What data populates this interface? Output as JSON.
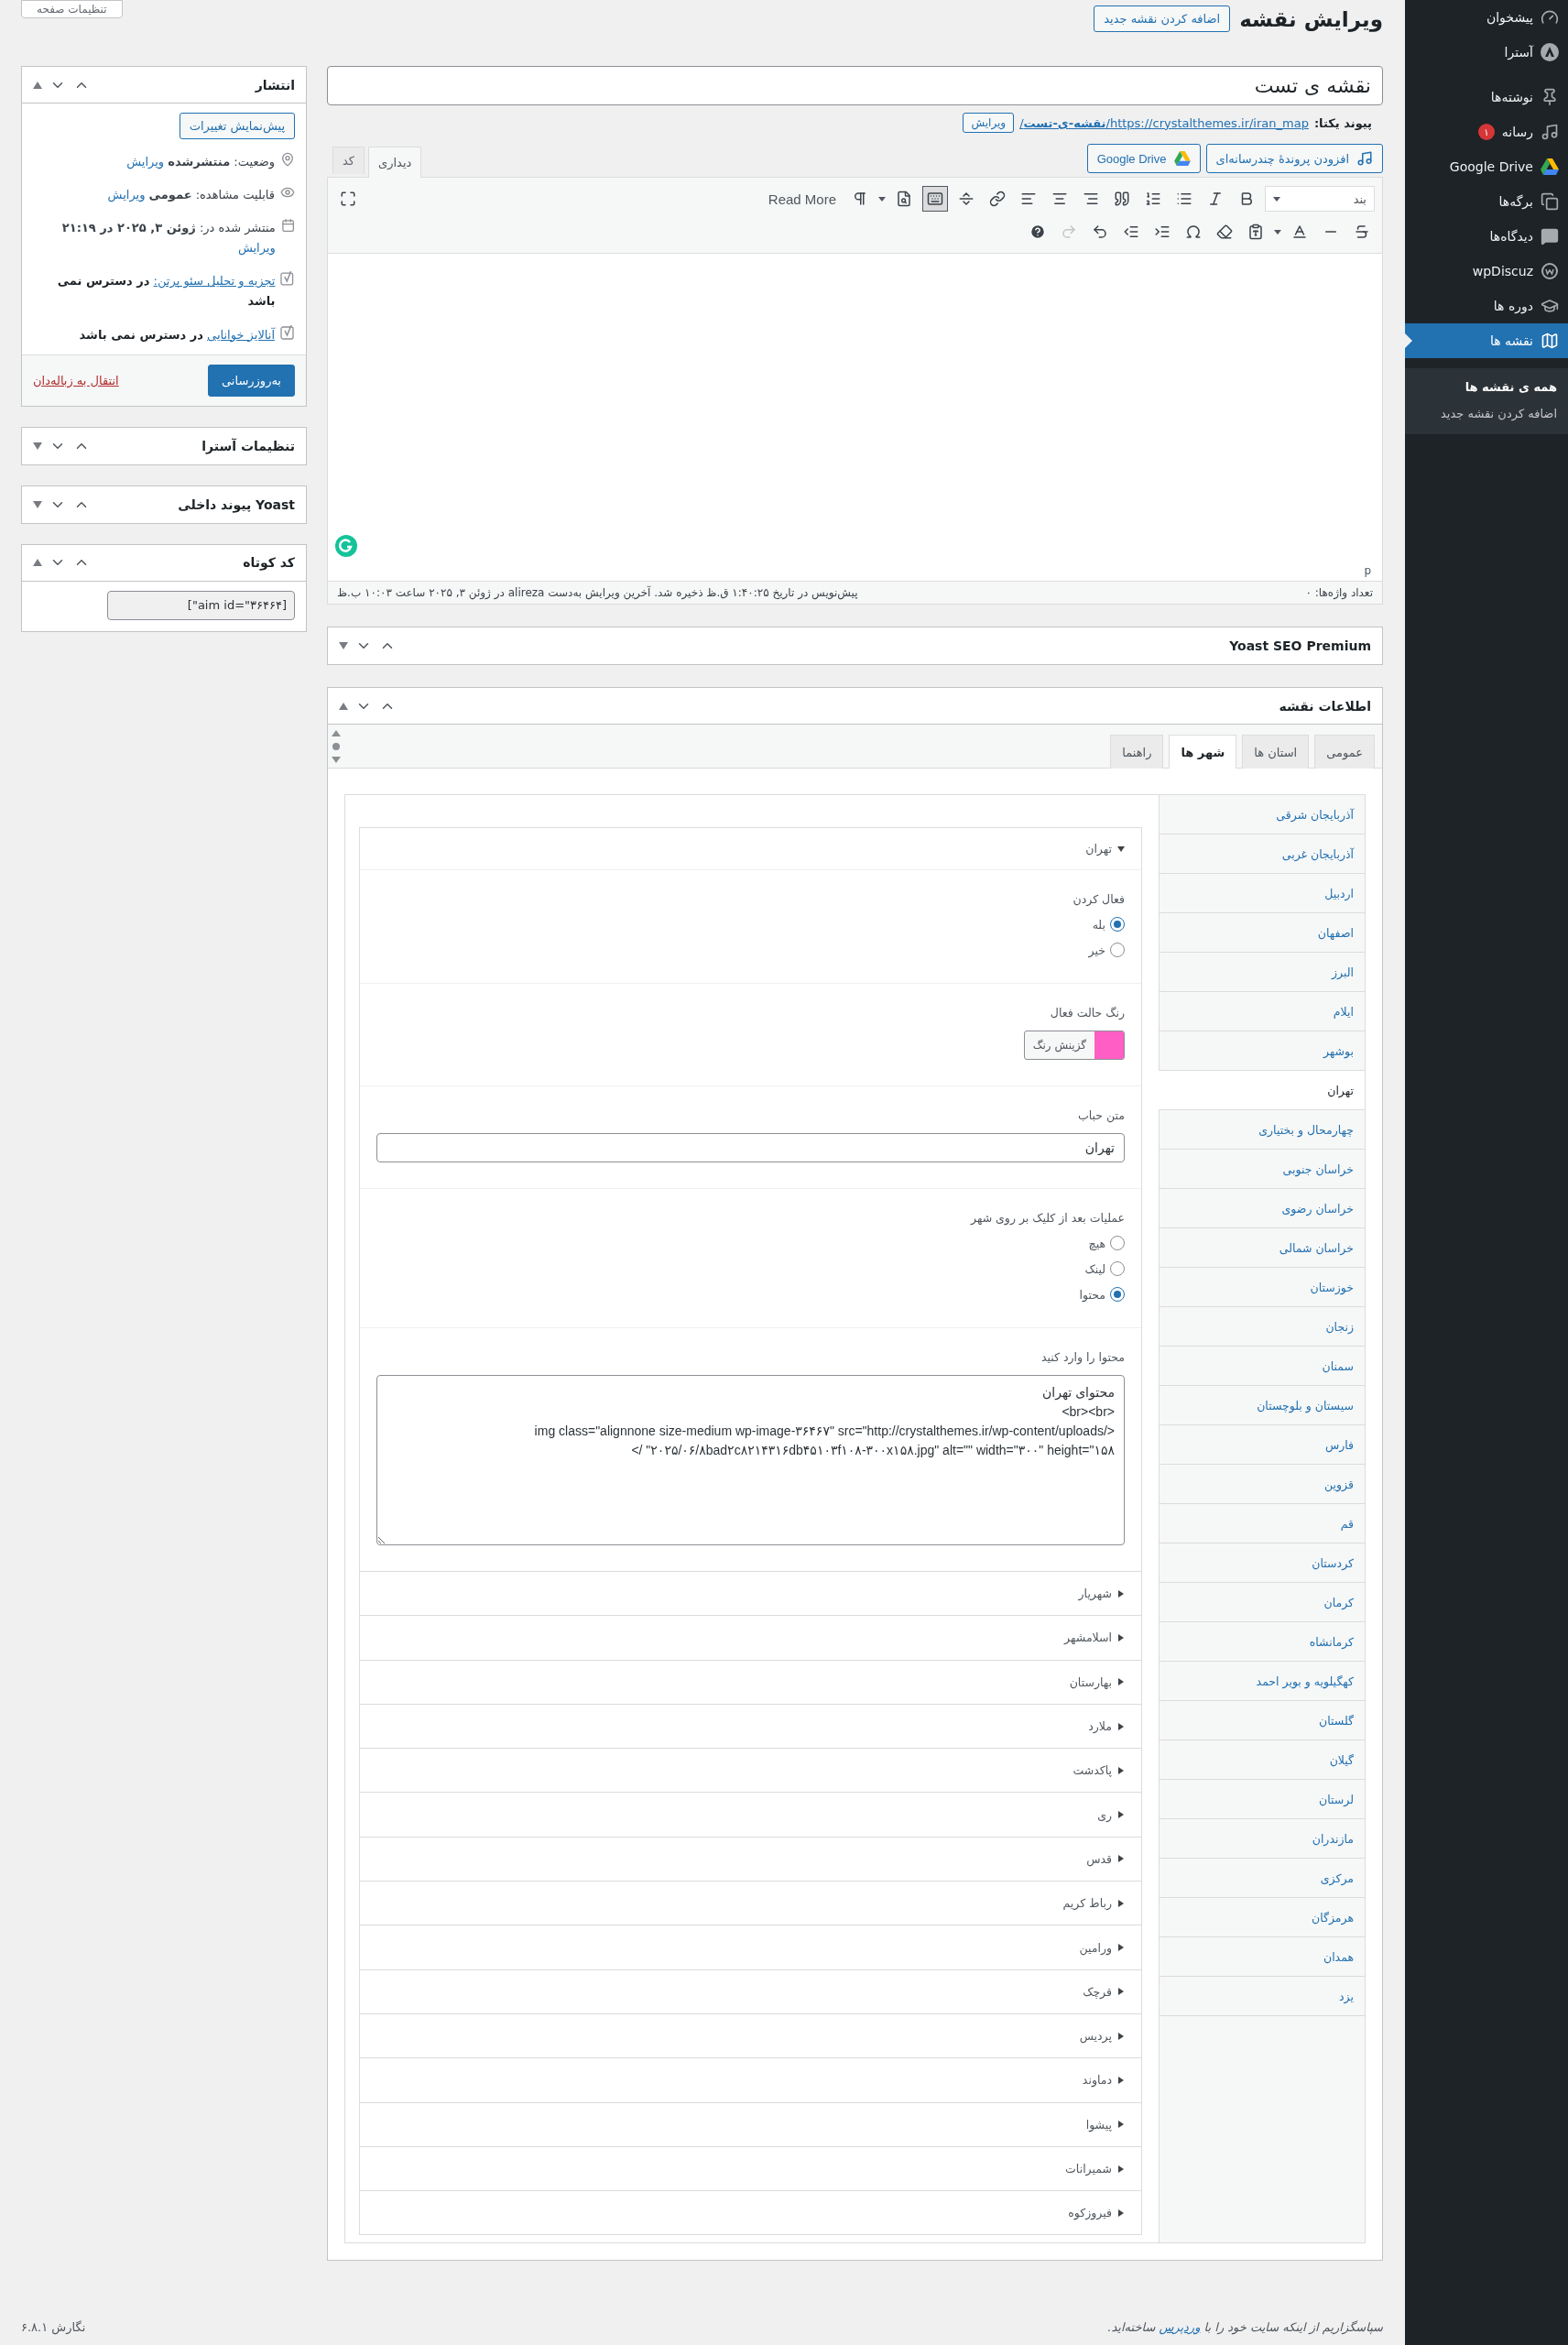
{
  "admin_menu": {
    "groups": [
      [
        {
          "label": "پیشخوان",
          "selected": false
        },
        {
          "label": "آسترا",
          "selected": false
        }
      ],
      [
        {
          "label": "نوشته‌ها",
          "selected": false
        },
        {
          "label": "رسانه",
          "selected": false,
          "badge": "۱"
        },
        {
          "label": "Google Drive",
          "selected": false
        },
        {
          "label": "برگه‌ها",
          "selected": false
        },
        {
          "label": "دیدگاه‌ها",
          "selected": false
        },
        {
          "label": "wpDiscuz",
          "selected": false
        },
        {
          "label": "دوره ها",
          "selected": false
        },
        {
          "label": "نقشه ها",
          "selected": true
        }
      ]
    ],
    "submenu": [
      {
        "label": "همه ی نقشه ها",
        "selected": true
      },
      {
        "label": "اضافه کردن نقشه جدید",
        "selected": false
      }
    ]
  },
  "screen_options": "تنظیمات صفحه",
  "header": {
    "title": "ویرایش نقشه",
    "add_new": "اضافه کردن نقشه جدید"
  },
  "post_title": "نقشه ی تست",
  "permalink": {
    "label": "پیوند یکتا:",
    "url": "https://crystalthemes.ir/iran_map/**نقشه-ی-تست**/",
    "edit": "ویرایش"
  },
  "editor": {
    "media_buttons": [
      "افزودن پروندهٔ چندرسانه‌ای",
      "Google Drive"
    ],
    "tabs": [
      {
        "label": "دیداری",
        "selected": true
      },
      {
        "label": "کد",
        "selected": false
      }
    ],
    "format": "بند",
    "read_more": "Read More",
    "path": "p",
    "word_count": "تعداد واژه‌ها: ۰",
    "save_note": "پیش‌نویس در تاریخ ۱:۴۰:۲۵ ق.ظ ذخیره شد. آخرین ویرایش به‌دست alireza در ژوئن ۳, ۲۰۲۵ ساعت ۱۰:۰۳ ب.ظ"
  },
  "yoast_box": {
    "title": "Yoast SEO Premium",
    "expanded": false
  },
  "map_info": {
    "title": "اطلاعات نقشه",
    "expanded": true,
    "tabs": [
      {
        "label": "عمومی",
        "selected": false
      },
      {
        "label": "استان ها",
        "selected": false
      },
      {
        "label": "شهر ها",
        "selected": true
      },
      {
        "label": "راهنما",
        "selected": false
      }
    ],
    "provinces": [
      {
        "label": "آذربایجان شرقی",
        "selected": false
      },
      {
        "label": "آذربایجان غربی",
        "selected": false
      },
      {
        "label": "اردبیل",
        "selected": false
      },
      {
        "label": "اصفهان",
        "selected": false
      },
      {
        "label": "البرز",
        "selected": false
      },
      {
        "label": "ایلام",
        "selected": false
      },
      {
        "label": "بوشهر",
        "selected": false
      },
      {
        "label": "تهران",
        "selected": true
      },
      {
        "label": "چهارمحال و بختیاری",
        "selected": false
      },
      {
        "label": "خراسان جنوبی",
        "selected": false
      },
      {
        "label": "خراسان رضوی",
        "selected": false
      },
      {
        "label": "خراسان شمالی",
        "selected": false
      },
      {
        "label": "خوزستان",
        "selected": false
      },
      {
        "label": "زنجان",
        "selected": false
      },
      {
        "label": "سمنان",
        "selected": false
      },
      {
        "label": "سیستان و بلوچستان",
        "selected": false
      },
      {
        "label": "فارس",
        "selected": false
      },
      {
        "label": "قزوین",
        "selected": false
      },
      {
        "label": "قم",
        "selected": false
      },
      {
        "label": "کردستان",
        "selected": false
      },
      {
        "label": "کرمان",
        "selected": false
      },
      {
        "label": "کرمانشاه",
        "selected": false
      },
      {
        "label": "کهگیلویه و بویر احمد",
        "selected": false
      },
      {
        "label": "گلستان",
        "selected": false
      },
      {
        "label": "گیلان",
        "selected": false
      },
      {
        "label": "لرستان",
        "selected": false
      },
      {
        "label": "مازندران",
        "selected": false
      },
      {
        "label": "مرکزی",
        "selected": false
      },
      {
        "label": "هرمزگان",
        "selected": false
      },
      {
        "label": "همدان",
        "selected": false
      },
      {
        "label": "یزد",
        "selected": false
      }
    ],
    "cities": [
      {
        "label": "تهران",
        "expanded": true,
        "fields": [
          {
            "kind": "radio",
            "label": "فعال کردن",
            "options": [
              {
                "label": "بله",
                "selected": true
              },
              {
                "label": "خیر",
                "selected": false
              }
            ]
          },
          {
            "kind": "color",
            "label": "رنگ حالت فعال",
            "color": "#ff5ec4",
            "button": "گزینش رنگ"
          },
          {
            "kind": "text",
            "label": "متن حباب",
            "value": "تهران"
          },
          {
            "kind": "radio",
            "label": "عملیات بعد از کلیک بر روی شهر",
            "options": [
              {
                "label": "هیچ",
                "selected": false
              },
              {
                "label": "لینک",
                "selected": false
              },
              {
                "label": "محتوا",
                "selected": true
              }
            ]
          },
          {
            "kind": "textarea",
            "label": "محتوا را وارد کنید",
            "value": "محتوای تهران\n<br><br>\n<img class=\"alignnone size-medium wp-image-۳۶۴۶۷\" src=\"http://crystalthemes.ir/wp-content/uploads/۲۰۲۵/۰۶/۸bad۲c۸۲۱۴۳۱۶db۴۵۱۰۳f۱۰۸-۳۰۰x۱۵۸.jpg\" alt=\"\" width=\"۳۰۰\" height=\"۱۵۸\" />"
          }
        ]
      },
      {
        "label": "شهریار",
        "expanded": false
      },
      {
        "label": "اسلامشهر",
        "expanded": false
      },
      {
        "label": "بهارستان",
        "expanded": false
      },
      {
        "label": "ملارد",
        "expanded": false
      },
      {
        "label": "پاکدشت",
        "expanded": false
      },
      {
        "label": "ری",
        "expanded": false
      },
      {
        "label": "قدس",
        "expanded": false
      },
      {
        "label": "رباط کریم",
        "expanded": false
      },
      {
        "label": "ورامین",
        "expanded": false
      },
      {
        "label": "قرچک",
        "expanded": false
      },
      {
        "label": "پردیس",
        "expanded": false
      },
      {
        "label": "دماوند",
        "expanded": false
      },
      {
        "label": "پیشوا",
        "expanded": false
      },
      {
        "label": "شمیرانات",
        "expanded": false
      },
      {
        "label": "فیروزکوه",
        "expanded": false
      }
    ]
  },
  "publish": {
    "title": "انتشار",
    "expanded": true,
    "preview": "پیش‌نمایش تغییرات",
    "rows": [
      {
        "kind": "status",
        "text": "وضعیت: **منتشرشده**",
        "link": "ویرایش"
      },
      {
        "kind": "visibility",
        "text": "قابلیت مشاهده: **عمومی**",
        "link": "ویرایش"
      },
      {
        "kind": "date",
        "text": "منتشر شده در: **ژوئن ۳, ۲۰۲۵ در ۲۱:۱۹**",
        "link": "ویرایش"
      },
      {
        "kind": "seo",
        "link": "تجزیه و تحلیل سئو پرتن:",
        "text": "در دسترس نمی باشد"
      },
      {
        "kind": "seo",
        "link": "آنالایز خوانایی",
        "text": "در دسترس نمی باشد"
      }
    ],
    "trash": "انتقال به زباله‌دان",
    "update": "به‌روزرسانی"
  },
  "side_boxes": [
    {
      "title": "تنظیمات آسترا",
      "expanded": false
    },
    {
      "title": "Yoast پیوند داخلی",
      "expanded": false
    },
    {
      "title": "کد کوتاه",
      "expanded": true,
      "value": "[aim id=\"۳۶۴۶۴\"]"
    }
  ],
  "footer": {
    "before": "سپاسگزاریم از اینکه سایت خود را با",
    "link": "وردپرس",
    "after": "ساخته‌اید.",
    "version": "نگارش ۶.۸.۱"
  }
}
